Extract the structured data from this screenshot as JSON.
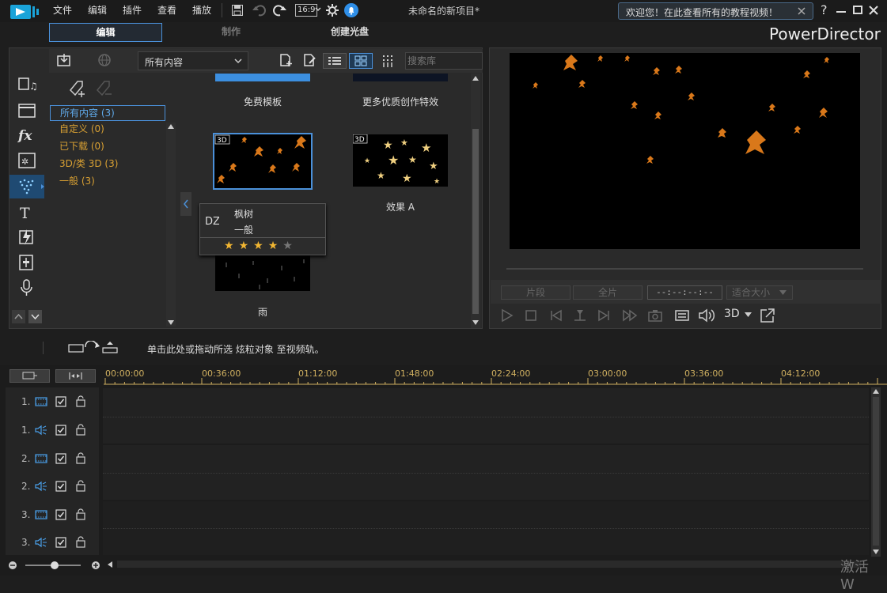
{
  "menu": {
    "file": "文件",
    "edit": "编辑",
    "plugin": "插件",
    "view": "查看",
    "play": "播放",
    "aspect": "16:9",
    "project_title": "未命名的新项目*",
    "welcome": "欢迎您！在此查看所有的教程视频！",
    "help": "?"
  },
  "tabs": {
    "edit": "编辑",
    "produce": "制作",
    "disc": "创建光盘"
  },
  "brand": "PowerDirector",
  "library": {
    "filter": "所有内容",
    "search_placeholder": "搜索库",
    "categories": [
      {
        "label": "所有内容 (3)"
      },
      {
        "label": "自定义  (0)"
      },
      {
        "label": "已下载  (0)"
      },
      {
        "label": "3D/类 3D  (3)"
      },
      {
        "label": "一般  (3)"
      }
    ],
    "items": [
      {
        "caption": "免费模板"
      },
      {
        "caption": "更多优质创作特效"
      },
      {
        "caption": "",
        "badge": "3D"
      },
      {
        "caption": "效果 A",
        "badge": "3D"
      },
      {
        "caption": "雨"
      }
    ],
    "tooltip": {
      "name": "枫树",
      "category": "一般",
      "rating": 4,
      "rating_max": 5
    }
  },
  "preview": {
    "mode_clip": "片段",
    "mode_movie": "全片",
    "timecode": "--:--:--:--",
    "fit": "适合大小",
    "three_d": "3D"
  },
  "timeline": {
    "hint": "单击此处或拖动所选 炫粒对象 至视频轨。",
    "ruler": [
      "00:00:00",
      "00:36:00",
      "01:12:00",
      "01:48:00",
      "02:24:00",
      "03:00:00",
      "03:36:00",
      "04:12:00"
    ],
    "tracks": [
      {
        "num": "1.",
        "type": "video"
      },
      {
        "num": "1.",
        "type": "audio"
      },
      {
        "num": "2.",
        "type": "video"
      },
      {
        "num": "2.",
        "type": "audio"
      },
      {
        "num": "3.",
        "type": "video"
      },
      {
        "num": "3.",
        "type": "audio"
      }
    ],
    "zoom_level": 0.45
  },
  "watermark": "激活 W",
  "colors": {
    "accent": "#4a90d9",
    "category": "#d8a033",
    "ruler": "#d0b060",
    "star": "#f2b632"
  }
}
